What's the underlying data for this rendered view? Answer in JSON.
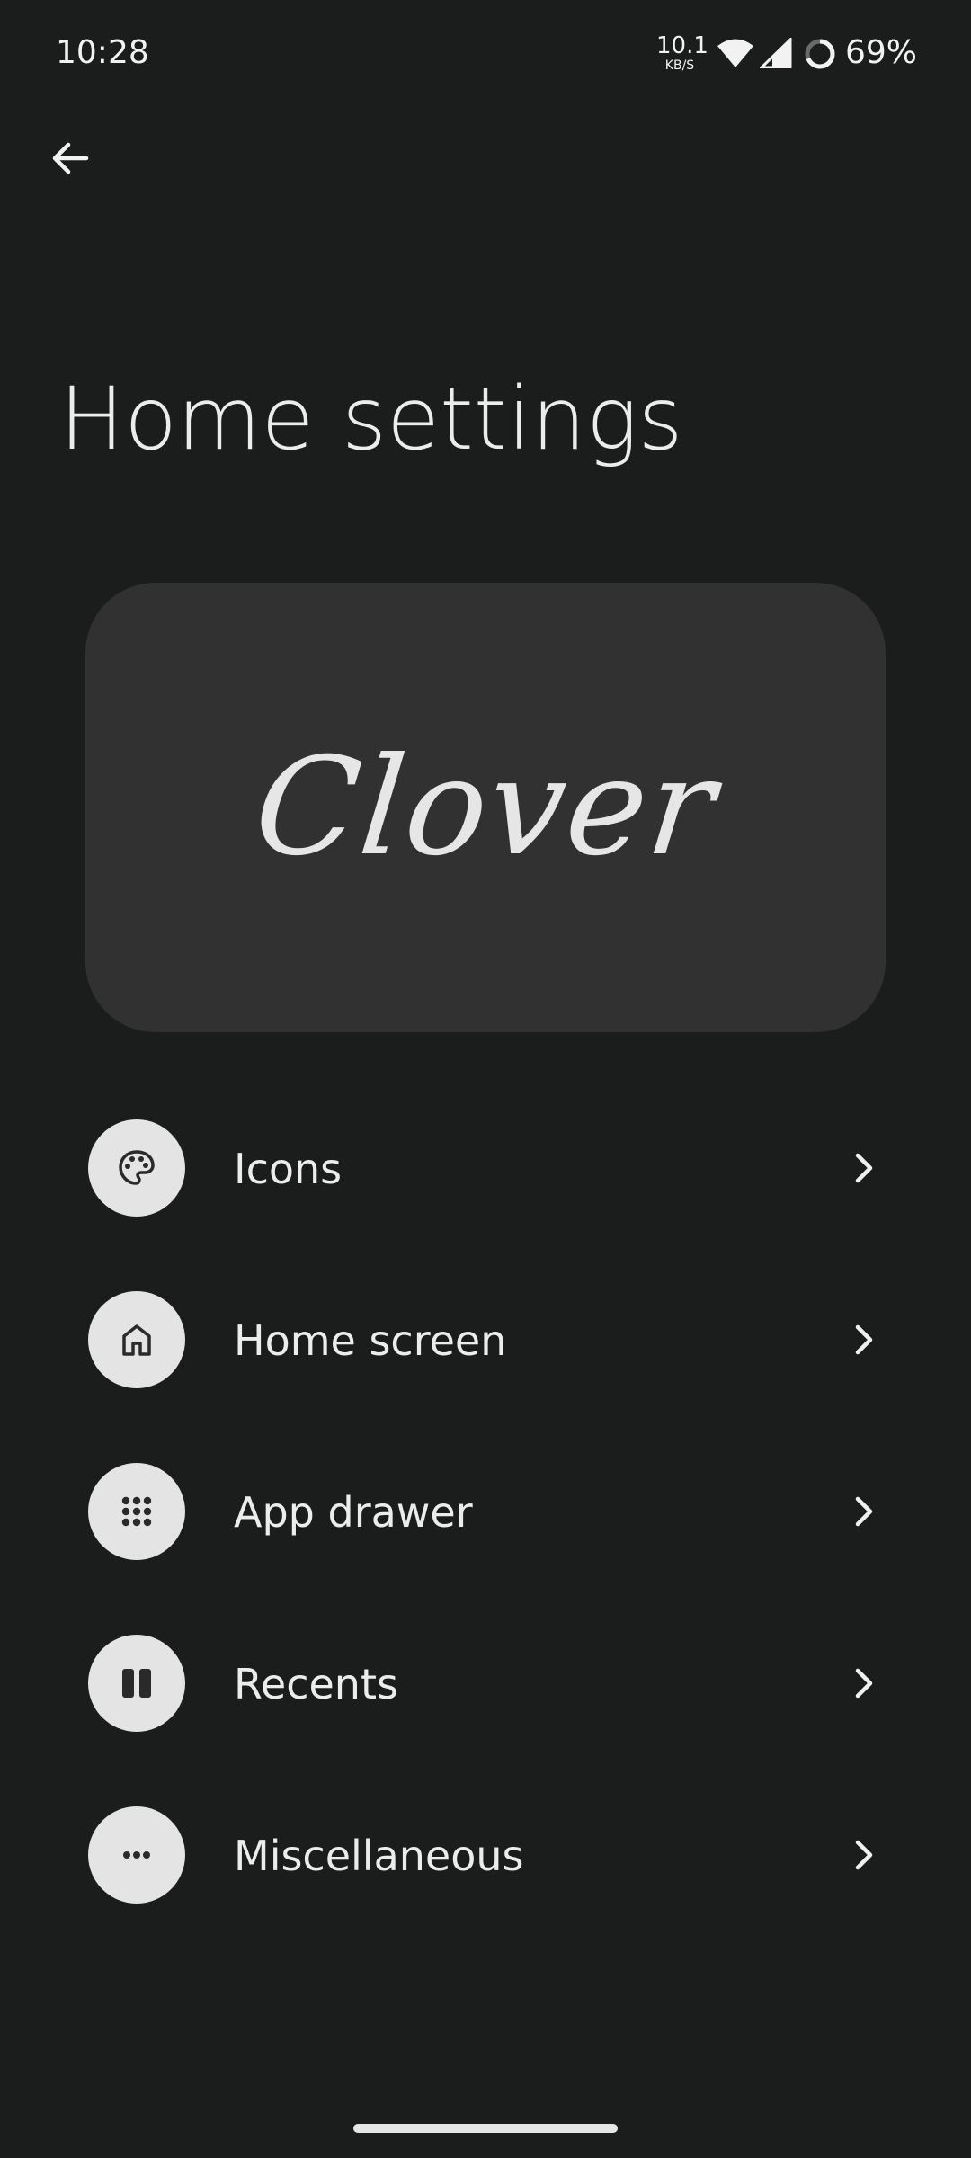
{
  "status_bar": {
    "time": "10:28",
    "net_speed_value": "10.1",
    "net_speed_unit": "KB/S",
    "battery_percent": "69%",
    "icons": [
      "wifi-icon",
      "signal-icon",
      "battery-ring-icon"
    ]
  },
  "header": {
    "back_icon": "arrow-left-icon",
    "title": "Home settings"
  },
  "hero": {
    "logo_text": "Clover"
  },
  "menu": {
    "items": [
      {
        "label": "Icons",
        "icon": "palette-icon"
      },
      {
        "label": "Home screen",
        "icon": "home-icon"
      },
      {
        "label": "App drawer",
        "icon": "grid-icon"
      },
      {
        "label": "Recents",
        "icon": "recents-icon"
      },
      {
        "label": "Miscellaneous",
        "icon": "more-horiz-icon"
      }
    ]
  },
  "colors": {
    "background": "#1b1c1c",
    "card": "#313131",
    "icon_circle": "#e4e4e4",
    "text": "#ececec"
  }
}
